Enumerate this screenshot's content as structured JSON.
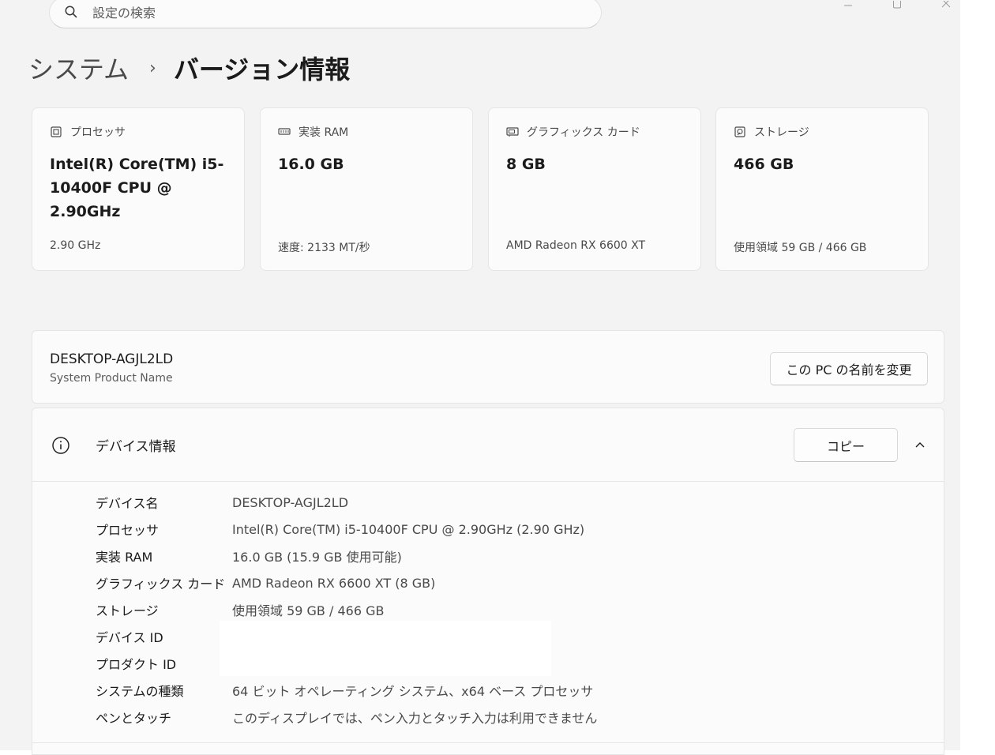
{
  "search": {
    "placeholder": "設定の検索"
  },
  "window_controls": [
    "minimize",
    "maximize",
    "close"
  ],
  "breadcrumb": {
    "parent": "システム",
    "separator": "›",
    "current": "バージョン情報"
  },
  "cards": [
    {
      "icon": "processor-icon",
      "label": "プロセッサ",
      "value": "Intel(R) Core(TM) i5-10400F CPU @ 2.90GHz",
      "sub": "2.90 GHz"
    },
    {
      "icon": "ram-icon",
      "label": "実装 RAM",
      "value": "16.0 GB",
      "sub": "速度: 2133 MT/秒"
    },
    {
      "icon": "graphics-card-icon",
      "label": "グラフィックス カード",
      "value": "8 GB",
      "sub": "AMD Radeon RX 6600 XT"
    },
    {
      "icon": "storage-icon",
      "label": "ストレージ",
      "value": "466 GB",
      "sub": "使用領域 59 GB / 466 GB"
    }
  ],
  "pc": {
    "name": "DESKTOP-AGJL2LD",
    "model": "System Product Name",
    "rename_label": "この PC の名前を変更"
  },
  "device_info": {
    "title": "デバイス情報",
    "copy_label": "コピー",
    "specs": [
      {
        "key": "デバイス名",
        "value": "DESKTOP-AGJL2LD"
      },
      {
        "key": "プロセッサ",
        "value": "Intel(R) Core(TM) i5-10400F CPU @ 2.90GHz (2.90 GHz)"
      },
      {
        "key": "実装 RAM",
        "value": "16.0 GB (15.9 GB 使用可能)"
      },
      {
        "key": "グラフィックス カード",
        "value": "AMD Radeon RX 6600 XT (8 GB)"
      },
      {
        "key": "ストレージ",
        "value": "使用領域 59 GB / 466 GB"
      },
      {
        "key": "デバイス ID",
        "value": ""
      },
      {
        "key": "プロダクト ID",
        "value": ""
      },
      {
        "key": "システムの種類",
        "value": "64 ビット オペレーティング システム、x64 ベース プロセッサ"
      },
      {
        "key": "ペンとタッチ",
        "value": "このディスプレイでは、ペン入力とタッチ入力は利用できません"
      }
    ]
  }
}
